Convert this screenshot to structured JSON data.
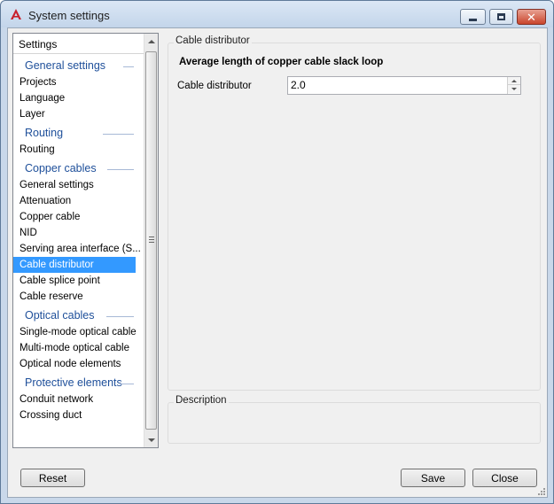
{
  "window": {
    "title": "System settings"
  },
  "tree": {
    "header": "Settings",
    "groups": [
      {
        "label": "General settings",
        "items": [
          "Projects",
          "Language",
          "Layer"
        ]
      },
      {
        "label": "Routing",
        "items": [
          "Routing"
        ]
      },
      {
        "label": "Copper cables",
        "items": [
          "General settings",
          "Attenuation",
          "Copper cable",
          "NID",
          "Serving area interface (S...",
          "Cable distributor",
          "Cable splice point",
          "Cable reserve"
        ]
      },
      {
        "label": "Optical cables",
        "items": [
          "Single-mode optical cable",
          "Multi-mode optical cable",
          "Optical node elements"
        ]
      },
      {
        "label": "Protective elements",
        "items": [
          "Conduit network",
          "Crossing duct"
        ]
      }
    ],
    "selected_item": "Cable distributor"
  },
  "main": {
    "groupbox_title": "Cable distributor",
    "section_heading": "Average length of copper cable slack loop",
    "property_label": "Cable distributor",
    "property_value": "2.0"
  },
  "description": {
    "title": "Description"
  },
  "buttons": {
    "reset": "Reset",
    "save": "Save",
    "close": "Close"
  },
  "colors": {
    "accent": "#3399ff",
    "group_text": "#1e4f9a",
    "close_button": "#c9452c"
  }
}
